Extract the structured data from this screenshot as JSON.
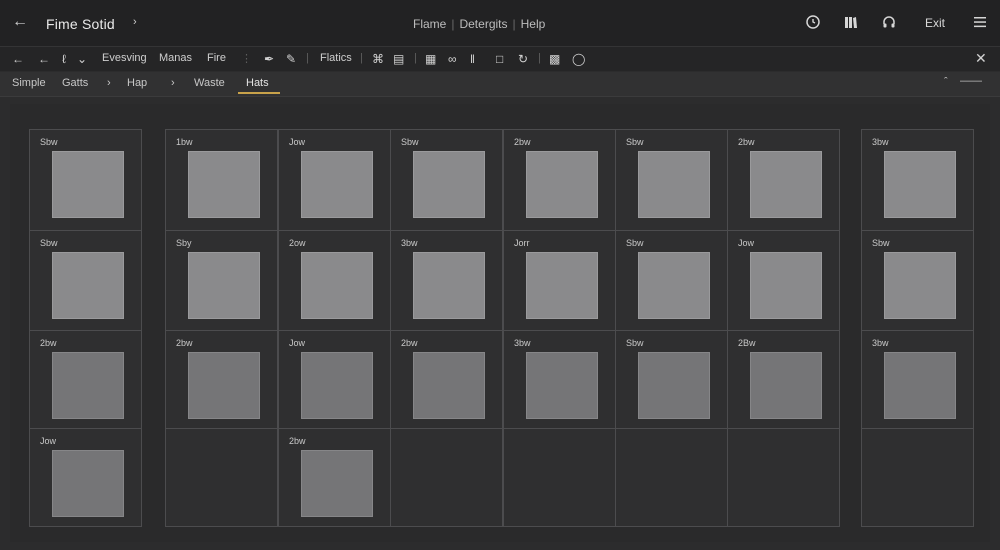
{
  "topbar": {
    "title": "Fime Sotid",
    "menu": [
      "Flame",
      "Detergits",
      "Help"
    ],
    "exit_label": "Exit"
  },
  "toolbar": {
    "labels": [
      "Evesving",
      "Manas",
      "Fire",
      "Flatics"
    ]
  },
  "breadcrumb": {
    "items": [
      "Simple",
      "Gatts",
      "Hap",
      "Waste",
      "Hats"
    ],
    "active_index": 4
  },
  "grid": {
    "left_column": [
      "Sbw",
      "Sbw",
      "2bw",
      "Jow"
    ],
    "main_rows": [
      [
        "1bw",
        "Jow",
        "Sbw",
        "2bw",
        "Sbw",
        "2bw"
      ],
      [
        "Sby",
        "2ow",
        "3bw",
        "Jorr",
        "Sbw",
        "Jow"
      ],
      [
        "2bw",
        "Jow",
        "2bw",
        "3bw",
        "Sbw",
        "2Bw"
      ],
      [
        "",
        "2bw",
        "",
        "",
        "",
        ""
      ]
    ],
    "right_column": [
      "3bw",
      "Sbw",
      "3bw",
      ""
    ]
  }
}
